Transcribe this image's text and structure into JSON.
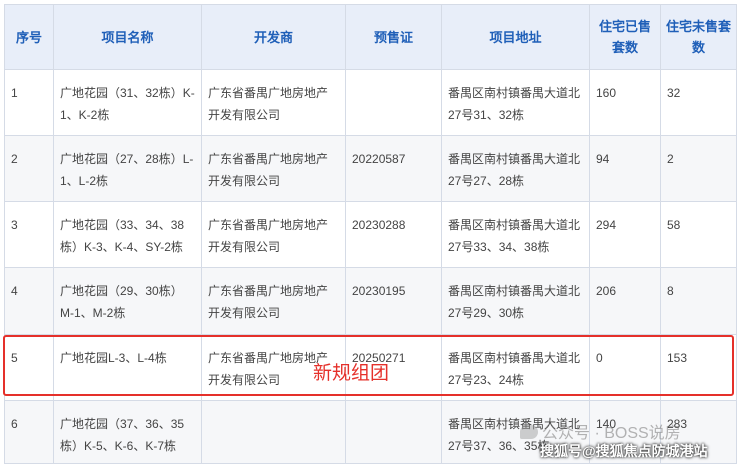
{
  "table": {
    "headers": [
      "序号",
      "项目名称",
      "开发商",
      "预售证",
      "项目地址",
      "住宅已售套数",
      "住宅未售套数"
    ],
    "rows": [
      {
        "no": "1",
        "name": "广地花园（31、32栋）K-1、K-2栋",
        "developer": "广东省番禺广地房地产开发有限公司",
        "permit": "",
        "address": "番禺区南村镇番禺大道北27号31、32栋",
        "sold": "160",
        "unsold": "32"
      },
      {
        "no": "2",
        "name": "广地花园（27、28栋）L-1、L-2栋",
        "developer": "广东省番禺广地房地产开发有限公司",
        "permit": "20220587",
        "address": "番禺区南村镇番禺大道北27号27、28栋",
        "sold": "94",
        "unsold": "2"
      },
      {
        "no": "3",
        "name": "广地花园（33、34、38栋）K-3、K-4、SY-2栋",
        "developer": "广东省番禺广地房地产开发有限公司",
        "permit": "20230288",
        "address": "番禺区南村镇番禺大道北27号33、34、38栋",
        "sold": "294",
        "unsold": "58"
      },
      {
        "no": "4",
        "name": "广地花园（29、30栋）M-1、M-2栋",
        "developer": "广东省番禺广地房地产开发有限公司",
        "permit": "20230195",
        "address": "番禺区南村镇番禺大道北27号29、30栋",
        "sold": "206",
        "unsold": "8"
      },
      {
        "no": "5",
        "name": "广地花园L-3、L-4栋",
        "developer": "广东省番禺广地房地产开发有限公司",
        "permit": "20250271",
        "address": "番禺区南村镇番禺大道北27号23、24栋",
        "sold": "0",
        "unsold": "153"
      },
      {
        "no": "6",
        "name": "广地花园（37、36、35栋）K-5、K-6、K-7栋",
        "developer": "",
        "permit": "",
        "address": "番禺区南村镇番禺大道北27号37、36、35栋",
        "sold": "140",
        "unsold": "283"
      }
    ]
  },
  "annotation": "新规组团",
  "watermark": {
    "line1": "公众号 · BOSS说房",
    "line2": "搜狐号@搜狐焦点防城港站"
  },
  "colors": {
    "header_bg": "#e8eef9",
    "header_text": "#1f5fb8",
    "highlight": "#e5302a"
  }
}
